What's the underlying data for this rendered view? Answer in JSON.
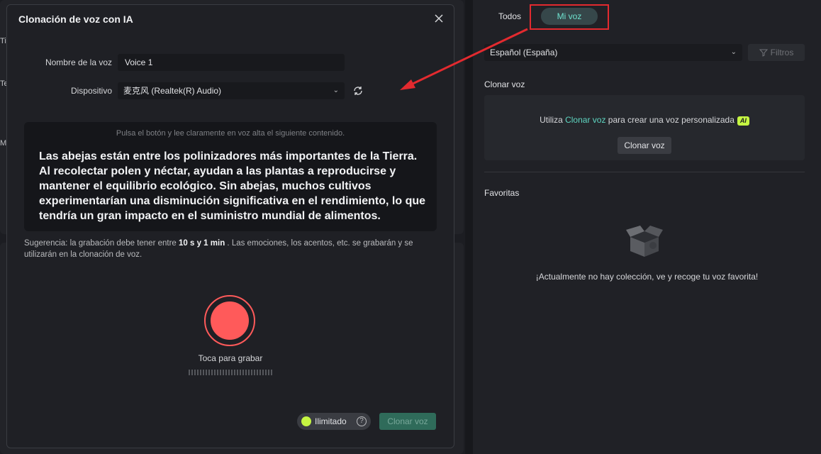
{
  "dialog": {
    "title": "Clonación de voz con IA",
    "name_label": "Nombre de la voz",
    "name_value": "Voice 1",
    "device_label": "Dispositivo",
    "device_value": "麦克风 (Realtek(R) Audio)",
    "read_hint": "Pulsa el botón y lee claramente en voz alta el siguiente contenido.",
    "read_text": "Las abejas están entre los polinizadores más importantes de la Tierra. Al recolectar polen y néctar, ayudan a las plantas a reproducirse y mantener el equilibrio ecológico. Sin abejas, muchos cultivos experimentarían una disminución significativa en el rendimiento, lo que tendría un gran impacto en el suministro mundial de alimentos.",
    "suggestion_prefix": "Sugerencia: la grabación debe tener entre ",
    "suggestion_bold": "10 s y 1 min",
    "suggestion_suffix": " . Las emociones, los acentos, etc. se grabarán y se utilizarán en la clonación de voz.",
    "record_label": "Toca para grabar",
    "unlimited_label": "Ilimitado",
    "help_symbol": "?",
    "clone_button": "Clonar voz"
  },
  "right_panel": {
    "tabs": [
      "Todos",
      "Mi voz"
    ],
    "language": "Español (España)",
    "filters": "Filtros",
    "clone_section_title": "Clonar voz",
    "clone_text_prefix": "Utiliza ",
    "clone_text_link": "Clonar voz",
    "clone_text_suffix": " para crear una voz personalizada",
    "ai_badge": "AI",
    "clone_card_button": "Clonar voz",
    "favorites_title": "Favoritas",
    "empty_text": "¡Actualmente no hay colección, ve y recoge tu voz favorita!"
  },
  "background_letters": [
    "Ti",
    "Te",
    "M"
  ],
  "colors": {
    "accent": "#5fd7c2",
    "record": "#ff5a5a",
    "annotation": "#e32a2f",
    "ai_badge": "#c5f542"
  }
}
